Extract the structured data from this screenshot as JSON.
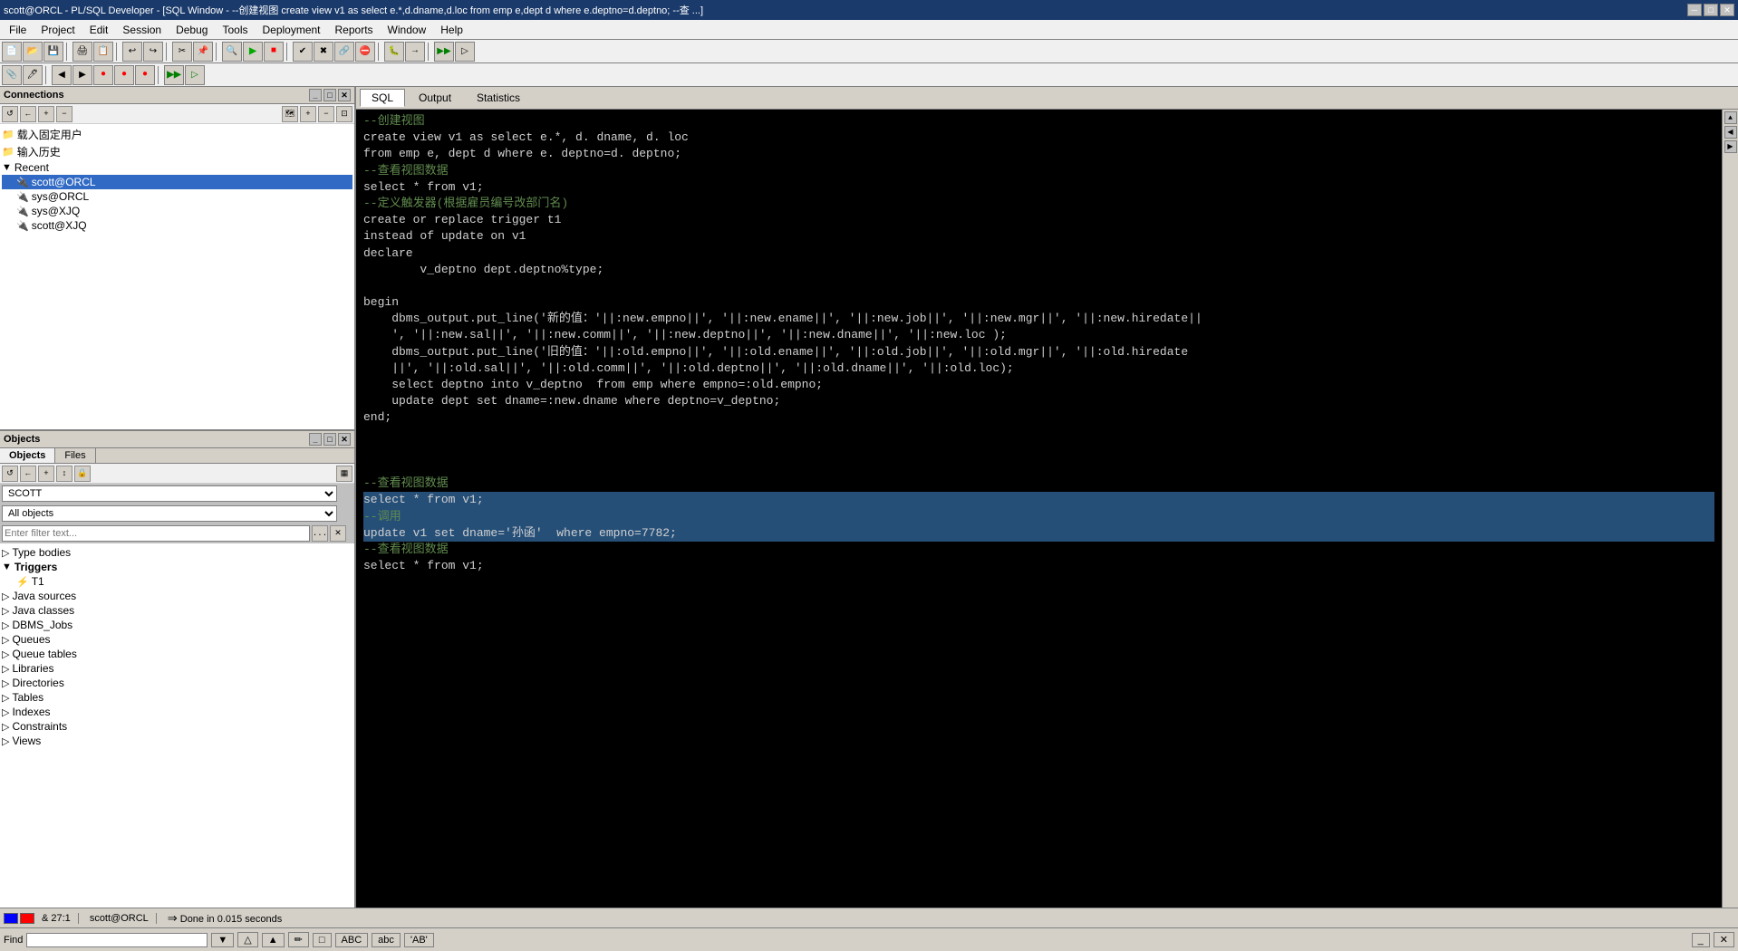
{
  "titleBar": {
    "text": "scott@ORCL - PL/SQL Developer - [SQL Window - --创建视图 create view v1 as select e.*,d.dname,d.loc from emp e,dept d where e.deptno=d.deptno; --查 ...]",
    "minimize": "─",
    "restore": "□",
    "close": "✕",
    "winMin": "─",
    "winRestore": "□",
    "winClose": "✕"
  },
  "menuBar": {
    "items": [
      "File",
      "Project",
      "Edit",
      "Session",
      "Debug",
      "Tools",
      "Deployment",
      "Reports",
      "Window",
      "Help"
    ]
  },
  "connections": {
    "title": "Connections",
    "toolbar": {
      "buttons": [
        "↺",
        "←",
        "+",
        "−"
      ]
    },
    "tree": [
      {
        "indent": 0,
        "icon": "📁",
        "label": "载入固定用户",
        "selected": false
      },
      {
        "indent": 0,
        "icon": "📁",
        "label": "输入历史",
        "selected": false
      },
      {
        "indent": 0,
        "icon": "▼",
        "label": "Recent",
        "selected": false
      },
      {
        "indent": 1,
        "icon": "🔌",
        "label": "scott@ORCL",
        "selected": true
      },
      {
        "indent": 1,
        "icon": "🔌",
        "label": "sys@ORCL",
        "selected": false
      },
      {
        "indent": 1,
        "icon": "🔌",
        "label": "sys@XJQ",
        "selected": false
      },
      {
        "indent": 1,
        "icon": "🔌",
        "label": "scott@XJQ",
        "selected": false
      }
    ]
  },
  "objects": {
    "title": "Objects",
    "tabs": [
      "Objects",
      "Files"
    ],
    "activeTab": "Objects",
    "schema": "SCOTT",
    "filter": "All objects",
    "filterPlaceholder": "Enter filter text...",
    "tree": [
      {
        "indent": 0,
        "icon": "▷",
        "label": "Type bodies"
      },
      {
        "indent": 0,
        "icon": "▼",
        "label": "Triggers",
        "expanded": true,
        "bold": true
      },
      {
        "indent": 1,
        "icon": "⚡",
        "label": "T1"
      },
      {
        "indent": 0,
        "icon": "▷",
        "label": "Java sources"
      },
      {
        "indent": 0,
        "icon": "▷",
        "label": "Java classes"
      },
      {
        "indent": 0,
        "icon": "▷",
        "label": "DBMS_Jobs"
      },
      {
        "indent": 0,
        "icon": "▷",
        "label": "Queues"
      },
      {
        "indent": 0,
        "icon": "▷",
        "label": "Queue tables"
      },
      {
        "indent": 0,
        "icon": "▷",
        "label": "Libraries"
      },
      {
        "indent": 0,
        "icon": "▷",
        "label": "Directories"
      },
      {
        "indent": 0,
        "icon": "▷",
        "label": "Tables"
      },
      {
        "indent": 0,
        "icon": "▷",
        "label": "Indexes"
      },
      {
        "indent": 0,
        "icon": "▷",
        "label": "Constraints"
      },
      {
        "indent": 0,
        "icon": "▷",
        "label": "Views"
      }
    ]
  },
  "sqlEditor": {
    "tabs": [
      "SQL",
      "Output",
      "Statistics"
    ],
    "activeTab": "SQL",
    "code": [
      {
        "text": "--创建视图",
        "type": "comment",
        "selected": false
      },
      {
        "text": "create view v1 as select e.*, d. dname, d. loc",
        "type": "normal",
        "selected": false
      },
      {
        "text": "from emp e, dept d where e. deptno=d. deptno;",
        "type": "normal",
        "selected": false
      },
      {
        "text": "--查看视图数据",
        "type": "comment",
        "selected": false
      },
      {
        "text": "select * from v1;",
        "type": "normal",
        "selected": false
      },
      {
        "text": "--定义触发器(根据雇员编号改部门名)",
        "type": "comment",
        "selected": false
      },
      {
        "text": "create or replace trigger t1",
        "type": "normal",
        "selected": false
      },
      {
        "text": "instead of update on v1",
        "type": "normal",
        "selected": false
      },
      {
        "text": "declare",
        "type": "normal",
        "selected": false
      },
      {
        "text": "        v_deptno dept.deptno%type;",
        "type": "normal",
        "selected": false
      },
      {
        "text": "",
        "type": "normal",
        "selected": false
      },
      {
        "text": "begin",
        "type": "normal",
        "selected": false
      },
      {
        "text": "    dbms_output.put_line('新的值：'||:new.empno||', '||:new.ename||', '||:new.job||', '||:new.mgr||', '||:new.hiredate||",
        "type": "normal",
        "selected": false
      },
      {
        "text": "    ', '||:new.sal||', '||:new.comm||', '||:new.deptno||', '||:new.dname||', '||:new.loc );",
        "type": "normal",
        "selected": false
      },
      {
        "text": "    dbms_output.put_line('旧的值：'||:old.empno||', '||:old.ename||', '||:old.job||', '||:old.mgr||', '||:old.hiredate",
        "type": "normal",
        "selected": false
      },
      {
        "text": "    ||', '||:old.sal||', '||:old.comm||', '||:old.deptno||', '||:old.dname||', '||:old.loc);",
        "type": "normal",
        "selected": false
      },
      {
        "text": "    select deptno into v_deptno  from emp where empno=:old.empno;",
        "type": "normal",
        "selected": false
      },
      {
        "text": "    update dept set dname=:new.dname where deptno=v_deptno;",
        "type": "normal",
        "selected": false
      },
      {
        "text": "end;",
        "type": "normal",
        "selected": false
      },
      {
        "text": "",
        "type": "normal",
        "selected": false
      },
      {
        "text": "",
        "type": "normal",
        "selected": false
      },
      {
        "text": "",
        "type": "normal",
        "selected": false
      },
      {
        "text": "--查看视图数据",
        "type": "comment",
        "selected": false
      },
      {
        "text": "select * from v1;",
        "type": "normal",
        "selected": true
      },
      {
        "text": "--调用",
        "type": "comment",
        "selected": true
      },
      {
        "text": "update v1 set dname='孙函'  where empno=7782;",
        "type": "normal",
        "selected": true,
        "partialSelect": true
      },
      {
        "text": "--查看视图数据",
        "type": "comment",
        "selected": false
      },
      {
        "text": "select * from v1;",
        "type": "normal",
        "selected": false
      }
    ]
  },
  "statusBar": {
    "indicator1": "blue",
    "indicator2": "red",
    "position": "& 27:1",
    "connection": "scott@ORCL",
    "timing": "Done in 0.015 seconds"
  },
  "findBar": {
    "label": "Find",
    "inputValue": "",
    "buttons": [
      "▼",
      "△",
      "▲",
      "✏",
      "□",
      "ABC",
      "abc",
      "'AB'"
    ]
  }
}
